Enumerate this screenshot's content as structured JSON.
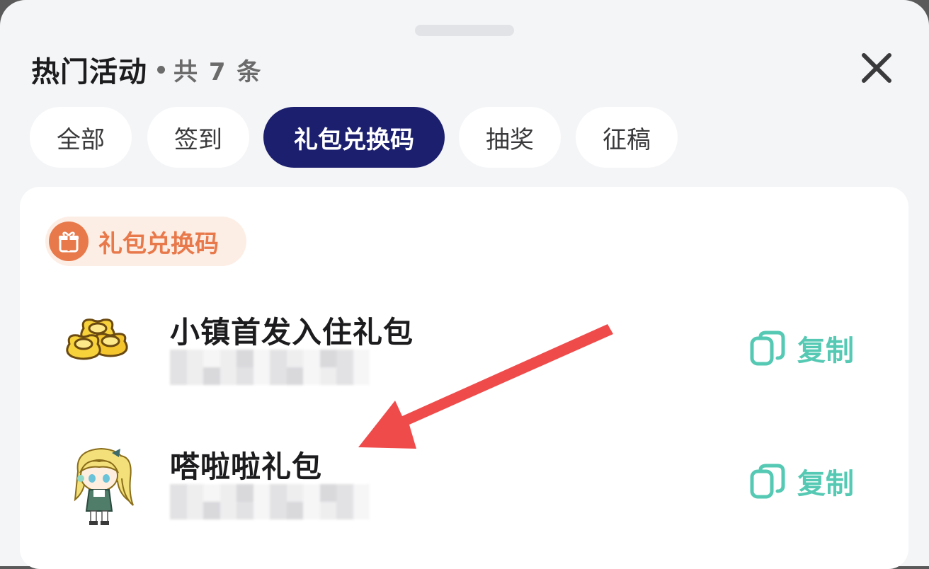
{
  "panel": {
    "title": "热门活动",
    "count_text": "共 7 条"
  },
  "tabs": [
    {
      "label": "全部",
      "active": false
    },
    {
      "label": "签到",
      "active": false
    },
    {
      "label": "礼包兑换码",
      "active": true
    },
    {
      "label": "抽奖",
      "active": false
    },
    {
      "label": "征稿",
      "active": false
    }
  ],
  "section": {
    "label": "礼包兑换码",
    "icon": "gift-icon"
  },
  "gifts": [
    {
      "name": "小镇首发入住礼包",
      "thumb_icon": "gold-ingot-icon",
      "copy_label": "复制",
      "copy_icon": "copy-icon"
    },
    {
      "name": "嗒啦啦礼包",
      "thumb_icon": "anime-character-icon",
      "copy_label": "复制",
      "copy_icon": "copy-icon"
    }
  ],
  "annotation": {
    "arrow_color": "#ef4b4b",
    "arrow_icon": "red-arrow-annotation"
  },
  "colors": {
    "active_tab": "#1c1f6e",
    "accent_orange": "#e8794b",
    "copy_green": "#55c9b3"
  }
}
